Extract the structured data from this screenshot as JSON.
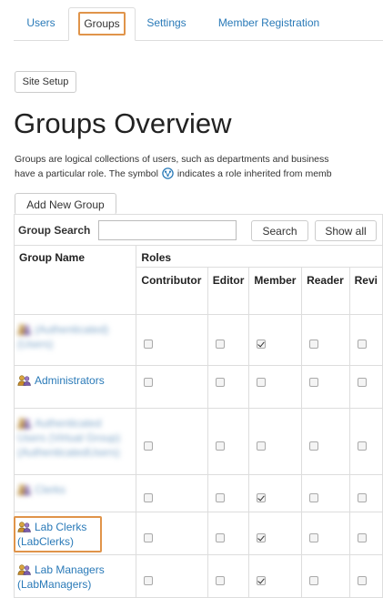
{
  "tabs": [
    {
      "label": "Users",
      "active": false
    },
    {
      "label": "Groups",
      "active": true
    },
    {
      "label": "Settings",
      "active": false
    },
    {
      "label": "Member Registration",
      "active": false
    }
  ],
  "site_setup_label": "Site Setup",
  "page_title": "Groups Overview",
  "description": {
    "line1": "Groups are logical collections of users, such as departments and business",
    "line2_before": "have a particular role. The symbol",
    "line2_after": "indicates a role inherited from memb",
    "inherit_icon": "inherited-role-icon"
  },
  "add_group_label": "Add New Group",
  "search": {
    "label": "Group Search",
    "value": "",
    "search_button": "Search",
    "show_all_button": "Show all"
  },
  "columns": {
    "group_name": "Group Name",
    "roles": "Roles",
    "role_names": [
      "Contributor",
      "Editor",
      "Member",
      "Reader",
      "Revi"
    ]
  },
  "rows": [
    {
      "line1": "(Authenticated) (Users)",
      "line2": "",
      "line3": "",
      "blurred": true,
      "roles": [
        false,
        false,
        true,
        false,
        false
      ]
    },
    {
      "line1": "Administrators",
      "line2": "",
      "line3": "",
      "blurred": false,
      "roles": [
        false,
        false,
        false,
        false,
        false
      ]
    },
    {
      "line1": "Authenticated",
      "line2": "Users (Virtual Group)",
      "line3": "(AuthenticatedUsers)",
      "blurred": true,
      "roles": [
        false,
        false,
        false,
        false,
        false
      ]
    },
    {
      "line1": "Clerks",
      "line2": "",
      "line3": "",
      "blurred": true,
      "roles": [
        false,
        false,
        true,
        false,
        false
      ]
    },
    {
      "line1": "Lab Clerks",
      "line2": "(LabClerks)",
      "line3": "",
      "blurred": false,
      "highlighted": true,
      "roles": [
        false,
        false,
        true,
        false,
        false
      ]
    },
    {
      "line1": "Lab Managers",
      "line2": "(LabManagers)",
      "line3": "",
      "blurred": false,
      "roles": [
        false,
        false,
        true,
        false,
        false
      ]
    }
  ],
  "colors": {
    "link": "#2a7ab8",
    "highlight": "#e0944a",
    "border": "#dddddd"
  }
}
